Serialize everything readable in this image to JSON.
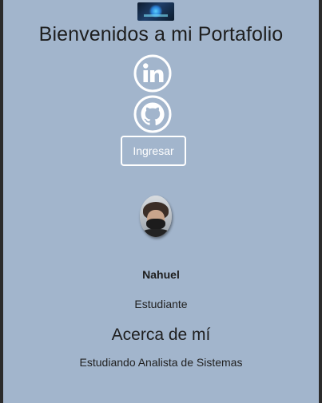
{
  "header": {
    "logo_icon": "portfolio-logo",
    "title": "Bienvenidos a mi Portafolio"
  },
  "social": {
    "linkedin_icon": "linkedin-icon",
    "github_icon": "github-icon",
    "icon_color": "#ffffff"
  },
  "actions": {
    "login_label": "Ingresar"
  },
  "profile": {
    "name": "Nahuel",
    "role": "Estudiante"
  },
  "about": {
    "title": "Acerca de mí",
    "text": "Estudiando Analista de Sistemas"
  },
  "theme": {
    "background": "#a2b5cc",
    "frame": "#2b2b2b",
    "text": "#1e1e1e"
  }
}
